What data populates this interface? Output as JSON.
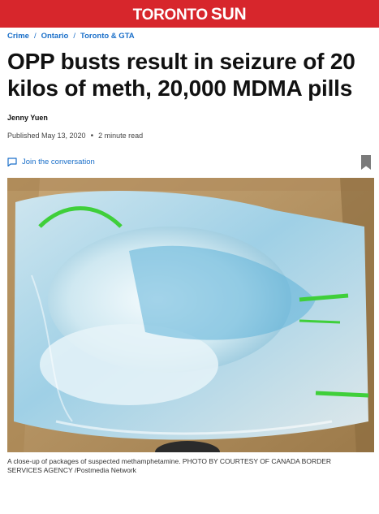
{
  "masthead": {
    "brand_first": "TORONTO",
    "brand_second": "SUN"
  },
  "breadcrumbs": [
    {
      "label": "Crime"
    },
    {
      "label": "Ontario"
    },
    {
      "label": "Toronto & GTA"
    }
  ],
  "breadcrumb_separator": "/",
  "article": {
    "headline": "OPP busts result in seizure of 20 kilos of meth, 20,000 MDMA pills",
    "author": "Jenny Yuen",
    "published": "Published May 13, 2020",
    "read_time": "2 minute read",
    "join_label": "Join the conversation",
    "caption": "A close-up of packages of suspected methamphetamine. PHOTO BY COURTESY OF CANADA BORDER SERVICES AGENCY /Postmedia Network"
  },
  "icons": {
    "comment": "comment-icon",
    "bookmark": "bookmark-icon"
  },
  "colors": {
    "brand": "#d7262c",
    "link": "#1a6fc9",
    "bookmark": "#7a7a7a"
  }
}
